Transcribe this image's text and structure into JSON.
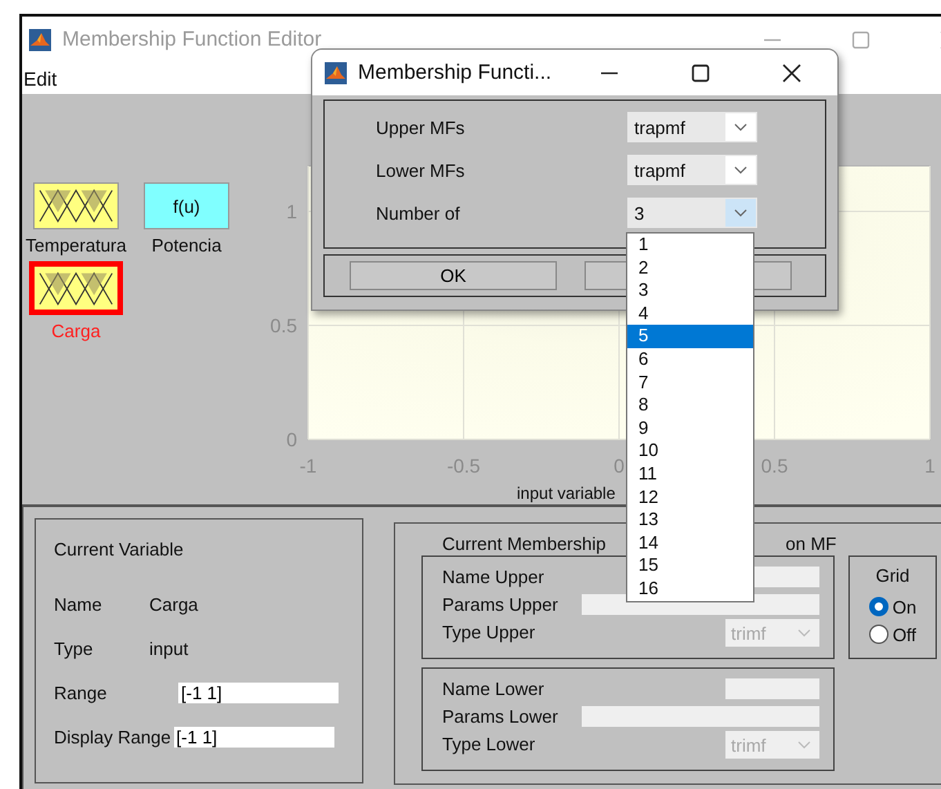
{
  "main_window": {
    "title": "Membership Function Editor",
    "active": false
  },
  "menu": [
    "Edit"
  ],
  "variables": [
    {
      "name": "Temperatura",
      "kind": "input",
      "selected": false
    },
    {
      "name": "Potencia",
      "kind": "output",
      "icon_text": "f(u)",
      "selected": false
    },
    {
      "name": "Carga",
      "kind": "input",
      "selected": true
    }
  ],
  "plot": {
    "chart_data": {
      "type": "line",
      "grid": true,
      "xlabel": "input variable",
      "xlim": [
        -1,
        1
      ],
      "ylim": [
        0,
        1.2
      ],
      "xticks": [
        {
          "value": -1,
          "label": "-1"
        },
        {
          "value": -0.5,
          "label": "-0.5"
        },
        {
          "value": 0,
          "label": "0"
        },
        {
          "value": 0.5,
          "label": "0.5"
        },
        {
          "value": 1,
          "label": "1"
        }
      ],
      "yticks": [
        {
          "value": 0,
          "label": "0"
        },
        {
          "value": 0.5,
          "label": "0.5"
        },
        {
          "value": 1,
          "label": "1"
        }
      ]
    }
  },
  "current_variable": {
    "heading": "Current Variable",
    "rows": [
      {
        "label": "Name",
        "kind": "text",
        "value": "Carga"
      },
      {
        "label": "Type",
        "kind": "text",
        "value": "input"
      },
      {
        "label": "Range",
        "kind": "field",
        "value": "[-1 1]"
      },
      {
        "label": "Display Range",
        "kind": "field",
        "value": "[-1 1]"
      }
    ]
  },
  "current_mf": {
    "legend_parts": [
      "Current Membership",
      "on MF"
    ],
    "groups": [
      [
        {
          "label": "Name Upper",
          "kind": "short_field"
        },
        {
          "label": "Params Upper",
          "kind": "long_field"
        },
        {
          "label": "Type Upper",
          "kind": "select",
          "value": "trimf",
          "disabled": true
        }
      ],
      [
        {
          "label": "Name Lower",
          "kind": "short_field"
        },
        {
          "label": "Params Lower",
          "kind": "long_field"
        },
        {
          "label": "Type Lower",
          "kind": "select",
          "value": "trimf",
          "disabled": true
        }
      ]
    ]
  },
  "grid": {
    "title": "Grid",
    "options": [
      {
        "label": "On",
        "selected": true
      },
      {
        "label": "Off",
        "selected": false
      }
    ]
  },
  "dialog": {
    "title": "Membership Functi...",
    "rows": [
      {
        "label": "Upper MFs",
        "value": "trapmf",
        "open": false
      },
      {
        "label": "Lower MFs",
        "value": "trapmf",
        "open": false
      },
      {
        "label": "Number of",
        "value": "3",
        "open": true
      }
    ],
    "buttons": [
      {
        "kind": "labeled",
        "label": "OK"
      },
      {
        "kind": "blank"
      }
    ]
  },
  "dropdown": {
    "items": [
      {
        "label": "1",
        "selected": false
      },
      {
        "label": "2",
        "selected": false
      },
      {
        "label": "3",
        "selected": false
      },
      {
        "label": "4",
        "selected": false
      },
      {
        "label": "5",
        "selected": true
      },
      {
        "label": "6",
        "selected": false
      },
      {
        "label": "7",
        "selected": false
      },
      {
        "label": "8",
        "selected": false
      },
      {
        "label": "9",
        "selected": false
      },
      {
        "label": "10",
        "selected": false
      },
      {
        "label": "11",
        "selected": false
      },
      {
        "label": "12",
        "selected": false
      },
      {
        "label": "13",
        "selected": false
      },
      {
        "label": "14",
        "selected": false
      },
      {
        "label": "15",
        "selected": false
      },
      {
        "label": "16",
        "selected": false
      }
    ]
  }
}
